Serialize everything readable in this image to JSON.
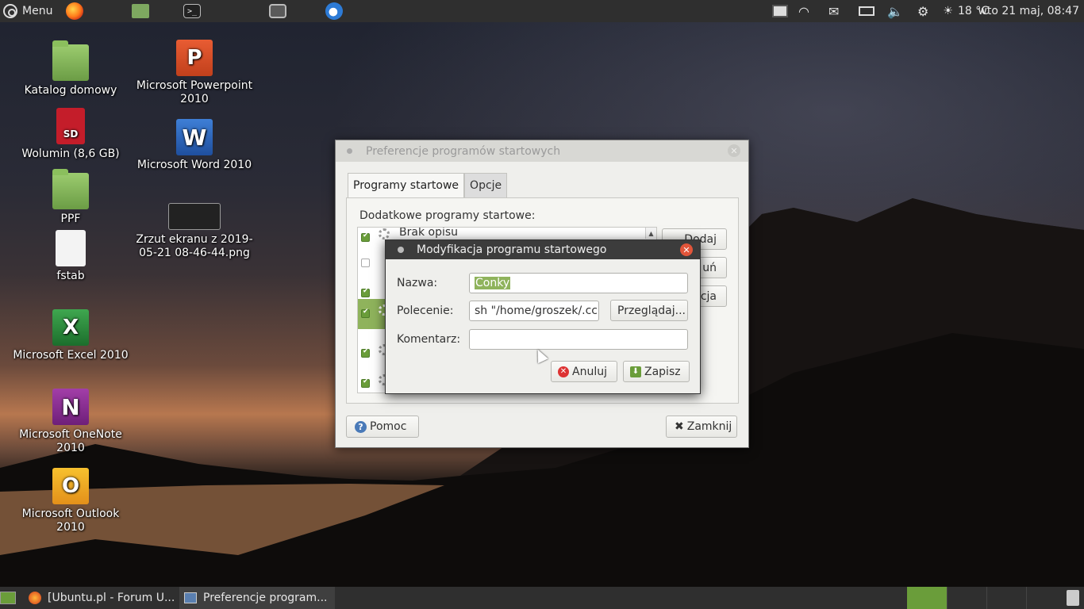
{
  "top_panel": {
    "menu_label": "Menu",
    "launchers": [
      "firefox-icon",
      "folder-icon",
      "terminal-icon",
      "screenshot-icon",
      "thunderbird-icon"
    ],
    "weather": "18 °C",
    "clock": "wto 21 maj, 08:47"
  },
  "desktop_icons": [
    {
      "label": "Katalog domowy",
      "icon": "home-folder-icon"
    },
    {
      "label": "Wolumin (8,6 GB)",
      "icon": "sd-card-icon",
      "badge": "SD"
    },
    {
      "label": "PPF",
      "icon": "folder-icon"
    },
    {
      "label": "fstab",
      "icon": "document-icon"
    },
    {
      "label": "Microsoft Excel 2010",
      "icon": "excel-icon",
      "letter": "X"
    },
    {
      "label": "Microsoft OneNote 2010",
      "icon": "onenote-icon",
      "letter": "N"
    },
    {
      "label": "Microsoft Outlook 2010",
      "icon": "outlook-icon",
      "letter": "O"
    },
    {
      "label": "Microsoft Powerpoint 2010",
      "icon": "powerpoint-icon",
      "letter": "P"
    },
    {
      "label": "Microsoft Word 2010",
      "icon": "word-icon",
      "letter": "W"
    },
    {
      "label": "Zrzut ekranu z 2019-05-21 08-46-44.png",
      "icon": "image-thumbnail-icon"
    }
  ],
  "main_window": {
    "title": "Preferencje programów startowych",
    "tabs": [
      {
        "label": "Programy startowe",
        "active": true
      },
      {
        "label": "Opcje",
        "active": false
      }
    ],
    "list_label": "Dodatkowe programy startowe:",
    "rows": [
      {
        "text": "Brak opisu",
        "checked": true,
        "selected": false
      },
      {
        "text": "",
        "checked": false,
        "selected": false
      },
      {
        "text": "",
        "checked": true,
        "selected": false
      },
      {
        "text": "",
        "checked": true,
        "selected": true
      },
      {
        "text": "",
        "checked": true,
        "selected": false
      },
      {
        "text": "",
        "checked": true,
        "selected": false
      }
    ],
    "side_buttons": [
      "Dodaj",
      "uń",
      "ycja"
    ],
    "help_label": "Pomoc",
    "close_label": "Zamknij"
  },
  "dialog": {
    "title": "Modyfikacja programu startowego",
    "name_label": "Nazwa:",
    "name_value": "Conky",
    "command_label": "Polecenie:",
    "command_value": "sh \"/home/groszek/.cc",
    "browse_label": "Przeglądaj...",
    "comment_label": "Komentarz:",
    "comment_value": "",
    "cancel_label": "Anuluj",
    "save_label": "Zapisz"
  },
  "taskbar": {
    "tasks": [
      {
        "label": "[Ubuntu.pl - Forum U...",
        "icon": "firefox-icon"
      },
      {
        "label": "Preferencje program...",
        "icon": "window-icon"
      }
    ]
  },
  "colors": {
    "accent": "#8fb35c",
    "panel": "#2f2f2f"
  }
}
